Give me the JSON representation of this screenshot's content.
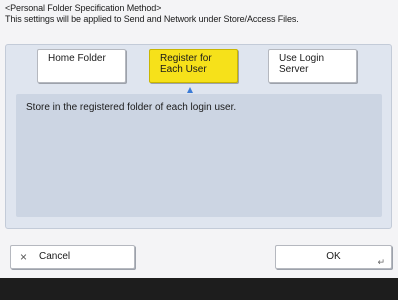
{
  "header": {
    "title": "<Personal Folder Specification Method>",
    "note": "This settings will be applied to Send and Network under Store/Access Files."
  },
  "options": [
    {
      "label_line1": "Home Folder",
      "label_line2": "",
      "selected": false
    },
    {
      "label_line1": "Register for",
      "label_line2": "Each User",
      "selected": true
    },
    {
      "label_line1": "Use Login",
      "label_line2": "Server",
      "selected": false
    }
  ],
  "description": "Store in the registered folder of each login user.",
  "buttons": {
    "cancel_icon": "×",
    "cancel": "Cancel",
    "ok": "OK",
    "enter_icon": "↵"
  },
  "colors": {
    "selected": "#f6e11a",
    "panel": "#dfe5ef",
    "description_bg": "#ccd5e3",
    "indicator": "#3b7bd6",
    "footer": "#1d1d1d"
  }
}
